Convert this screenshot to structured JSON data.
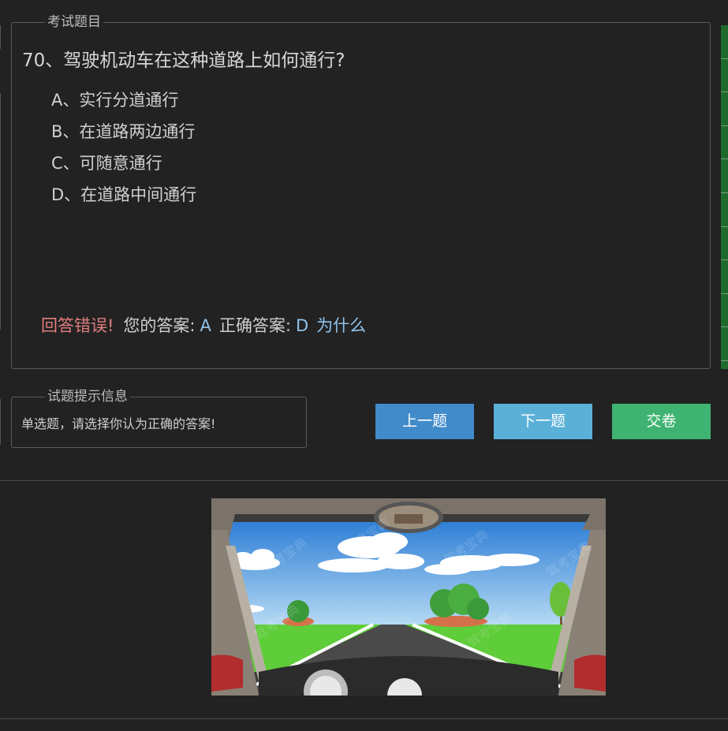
{
  "question_panel": {
    "legend": "考试题目",
    "title": "70、驾驶机动车在这种道路上如何通行?",
    "options": [
      "A、实行分道通行",
      "B、在道路两边通行",
      "C、可随意通行",
      "D、在道路中间通行"
    ],
    "result": {
      "status": "回答错误!",
      "your_answer_label": "您的答案:",
      "your_answer": "A",
      "correct_answer_label": "正确答案:",
      "correct_answer": "D",
      "why_link": "为什么"
    }
  },
  "hint_panel": {
    "legend": "试题提示信息",
    "text": "单选题，请选择你认为正确的答案!"
  },
  "buttons": {
    "prev": "上一题",
    "next": "下一题",
    "submit": "交卷"
  },
  "image": {
    "watermark": "驾考宝典"
  },
  "colors": {
    "background": "#222222",
    "wrong": "#e27d7d",
    "answer": "#8fc3ec",
    "prev_button": "#428bca",
    "next_button": "#5bb0d8",
    "submit_button": "#3fb371",
    "answer_card": "#1e6b2c"
  }
}
